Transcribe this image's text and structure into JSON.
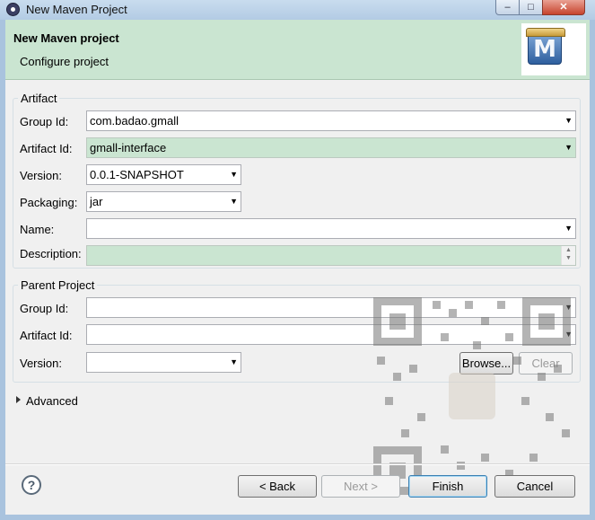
{
  "window": {
    "title": "New Maven Project",
    "min": "–",
    "max": "□",
    "close": "✕"
  },
  "header": {
    "title": "New Maven project",
    "subtitle": "Configure project",
    "logo_letter": "M",
    "bg_color": "#cae5d1"
  },
  "artifact": {
    "legend": "Artifact",
    "group_id": {
      "label": "Group Id:",
      "value": "com.badao.gmall"
    },
    "artifact_id": {
      "label": "Artifact Id:",
      "value": "gmall-interface"
    },
    "version": {
      "label": "Version:",
      "value": "0.0.1-SNAPSHOT"
    },
    "packaging": {
      "label": "Packaging:",
      "value": "jar"
    },
    "name": {
      "label": "Name:",
      "value": ""
    },
    "description": {
      "label": "Description:",
      "value": ""
    }
  },
  "parent": {
    "legend": "Parent Project",
    "group_id": {
      "label": "Group Id:",
      "value": ""
    },
    "artifact_id": {
      "label": "Artifact Id:",
      "value": ""
    },
    "version": {
      "label": "Version:",
      "value": ""
    },
    "browse_label": "Browse...",
    "clear_label": "Clear"
  },
  "advanced_label": "Advanced",
  "footer": {
    "help_glyph": "?",
    "back_label": "< Back",
    "next_label": "Next >",
    "finish_label": "Finish",
    "cancel_label": "Cancel"
  }
}
